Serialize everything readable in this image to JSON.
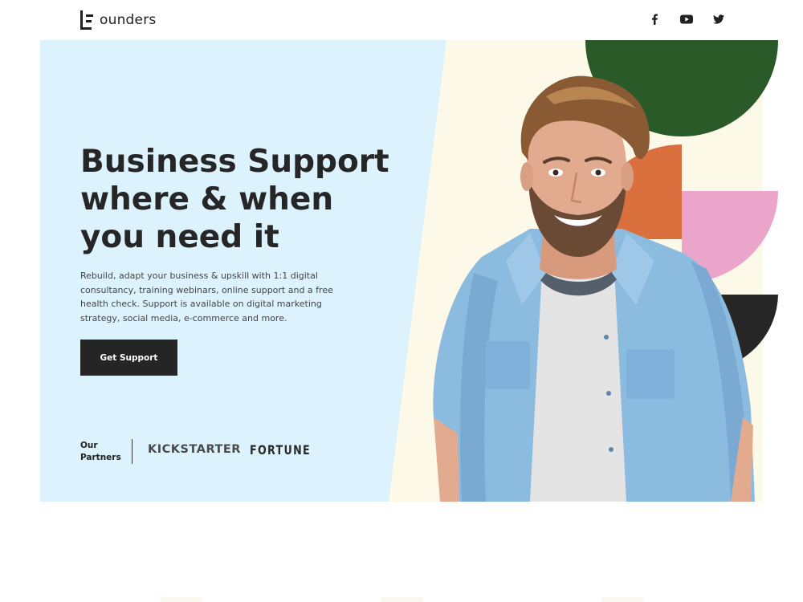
{
  "header": {
    "logo_text": "ounders",
    "socials": [
      {
        "name": "facebook-icon",
        "glyph": "f"
      },
      {
        "name": "youtube-icon"
      },
      {
        "name": "twitter-icon"
      }
    ]
  },
  "hero": {
    "title_lines": [
      "Business Support",
      "where & when",
      "you need it"
    ],
    "description": "Rebuild, adapt your business & upskill with 1:1 digital consultancy, training webinars, online support and a free health check. Support is available on digital marketing strategy, social media, e-commerce and more.",
    "cta_label": "Get Support",
    "partners_label_lines": [
      "Our",
      "Partners"
    ],
    "partners": [
      "KICKSTARTER",
      "FORTUNE"
    ]
  },
  "colors": {
    "hero_blue": "#dcf2fc",
    "hero_cream": "#fdf9e8",
    "button_dark": "#252525",
    "shape_green": "#2a5a27",
    "shape_orange": "#d9703e",
    "shape_pink": "#eba5ca",
    "shape_black": "#262626",
    "shirt_blue": "#8cbbe0"
  }
}
